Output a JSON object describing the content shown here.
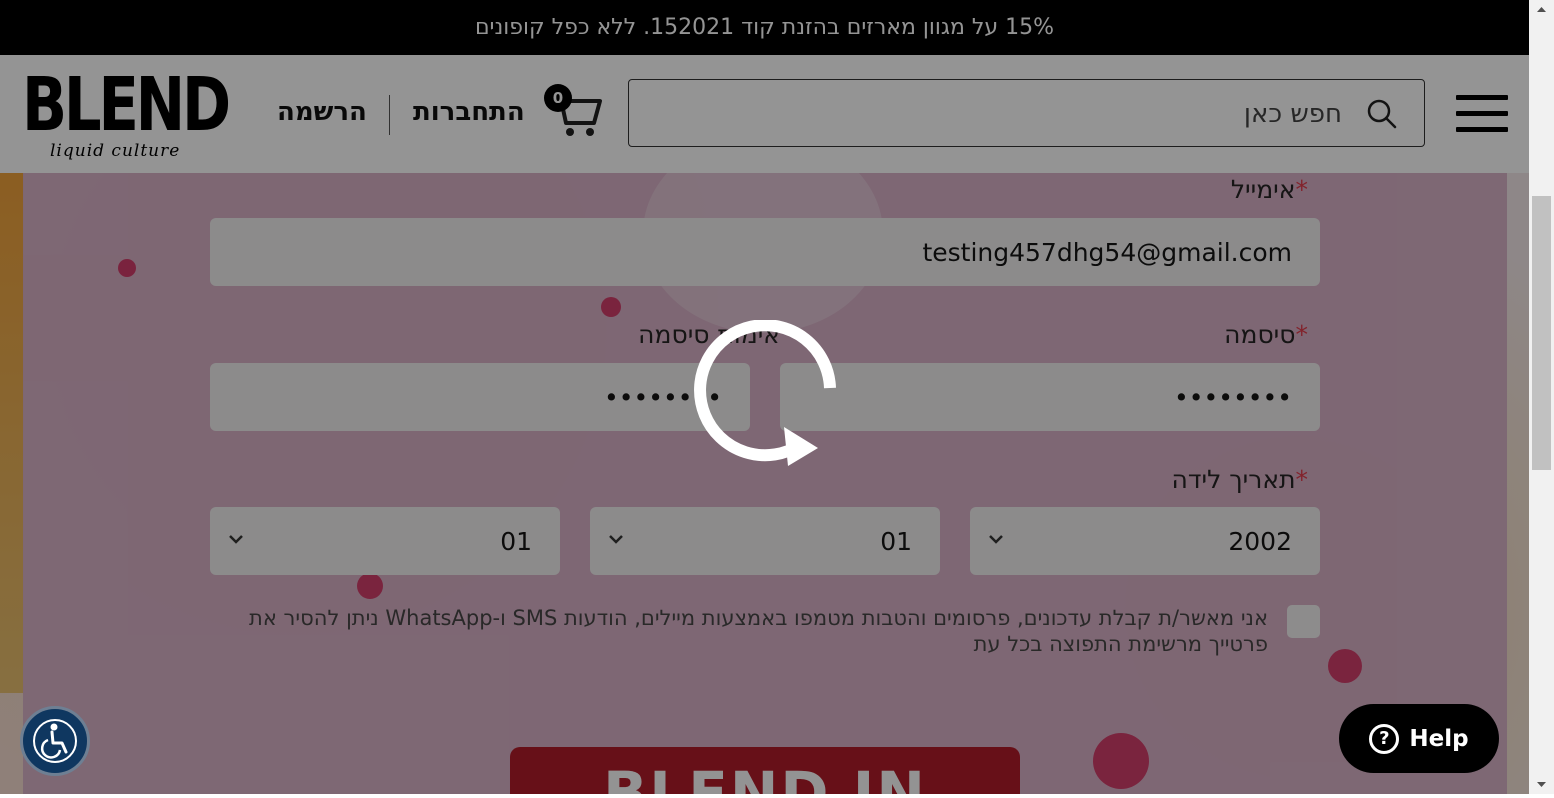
{
  "promo": {
    "text": "15% על מגוון מארזים בהזנת קוד 152021. ללא כפל קופונים"
  },
  "header": {
    "logo_main": "BLEND",
    "logo_sub": "liquid culture",
    "register_label": "הרשמה",
    "login_label": "התחברות",
    "cart_count": "0",
    "search_placeholder": "חפש כאן"
  },
  "form": {
    "email_label": "אימייל",
    "email_value": "testing457dhg54@gmail.com",
    "password_label": "סיסמה",
    "password_value": "••••••••",
    "confirm_password_label": "אימות סיסמה",
    "confirm_password_value": "••••••••",
    "birthdate_label": "תאריך לידה",
    "birth_year": "2002",
    "birth_month": "01",
    "birth_day": "01",
    "required_mark": "*",
    "consent_text": "אני מאשר/ת קבלת עדכונים, פרסומים והטבות מטמפו באמצעות מיילים, הודעות SMS ו-WhatsApp ניתן להסיר את פרטייך מרשימת התפוצה בכל עת",
    "submit_label": "BLEND IN"
  },
  "help": {
    "label": "Help"
  },
  "colors": {
    "accent_red": "#b11927",
    "required": "#e03a4a",
    "overlay": "rgba(0,0,0,0.42)"
  }
}
